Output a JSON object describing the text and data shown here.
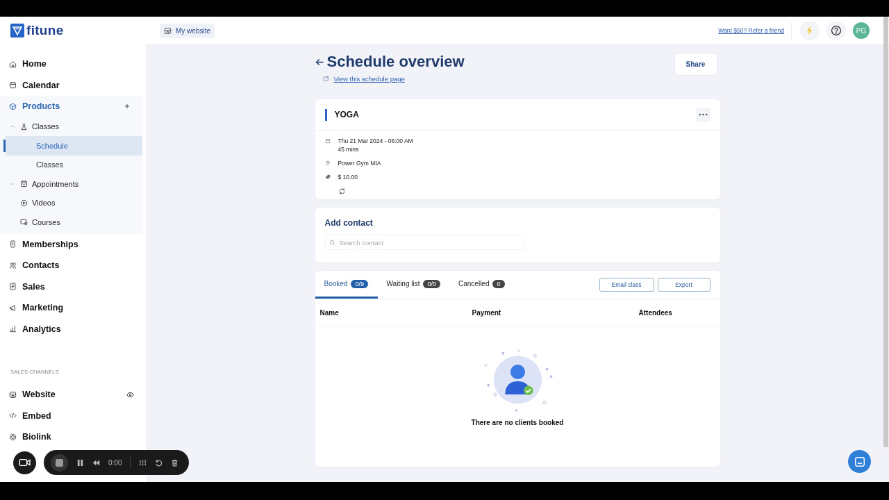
{
  "header": {
    "logo": "fitune",
    "website_button": "My website",
    "refer_link": "Want $50? Refer a friend",
    "avatar": "PG"
  },
  "sidebar": {
    "items": [
      {
        "label": "Home"
      },
      {
        "label": "Calendar"
      },
      {
        "label": "Products",
        "expanded": true,
        "children": [
          {
            "label": "Classes",
            "expanded": true,
            "children": [
              {
                "label": "Schedule",
                "selected": true
              },
              {
                "label": "Classes",
                "selected": false
              }
            ]
          },
          {
            "label": "Appointments",
            "expanded": false
          },
          {
            "label": "Videos"
          },
          {
            "label": "Courses"
          }
        ]
      },
      {
        "label": "Memberships"
      },
      {
        "label": "Contacts"
      },
      {
        "label": "Sales"
      },
      {
        "label": "Marketing"
      },
      {
        "label": "Analytics"
      }
    ],
    "section_label": "SALES CHANNELS",
    "channels": [
      {
        "label": "Website",
        "visible": true
      },
      {
        "label": "Embed",
        "visible": false
      },
      {
        "label": "Biolink",
        "visible": false
      }
    ]
  },
  "page": {
    "title": "Schedule overview",
    "view_link": "View this schedule page",
    "share_button": "Share"
  },
  "class_card": {
    "title": "YOGA",
    "details": [
      {
        "kind": "date",
        "lines": [
          "Thu 21 Mar 2024 - 06:00 AM",
          "45 mins"
        ]
      },
      {
        "kind": "location",
        "lines": [
          "Power Gym MIA"
        ]
      },
      {
        "kind": "price",
        "lines": [
          "$ 10.00"
        ]
      },
      {
        "kind": "recurring"
      }
    ]
  },
  "add_contact": {
    "title": "Add contact",
    "search": {
      "placeholder": "Search contact"
    }
  },
  "bookings": {
    "tabs": [
      {
        "label": "Booked",
        "count": "0/9",
        "selected": true
      },
      {
        "label": "Waiting list",
        "count": "0/0",
        "selected": false
      },
      {
        "label": "Cancelled",
        "count": "0",
        "selected": false
      }
    ],
    "buttons": [
      "Email class",
      "Export"
    ],
    "columns": [
      "Name",
      "Payment",
      "Attendees"
    ],
    "empty_message": "There are no clients booked"
  },
  "recorder": {
    "time": "0:00"
  }
}
